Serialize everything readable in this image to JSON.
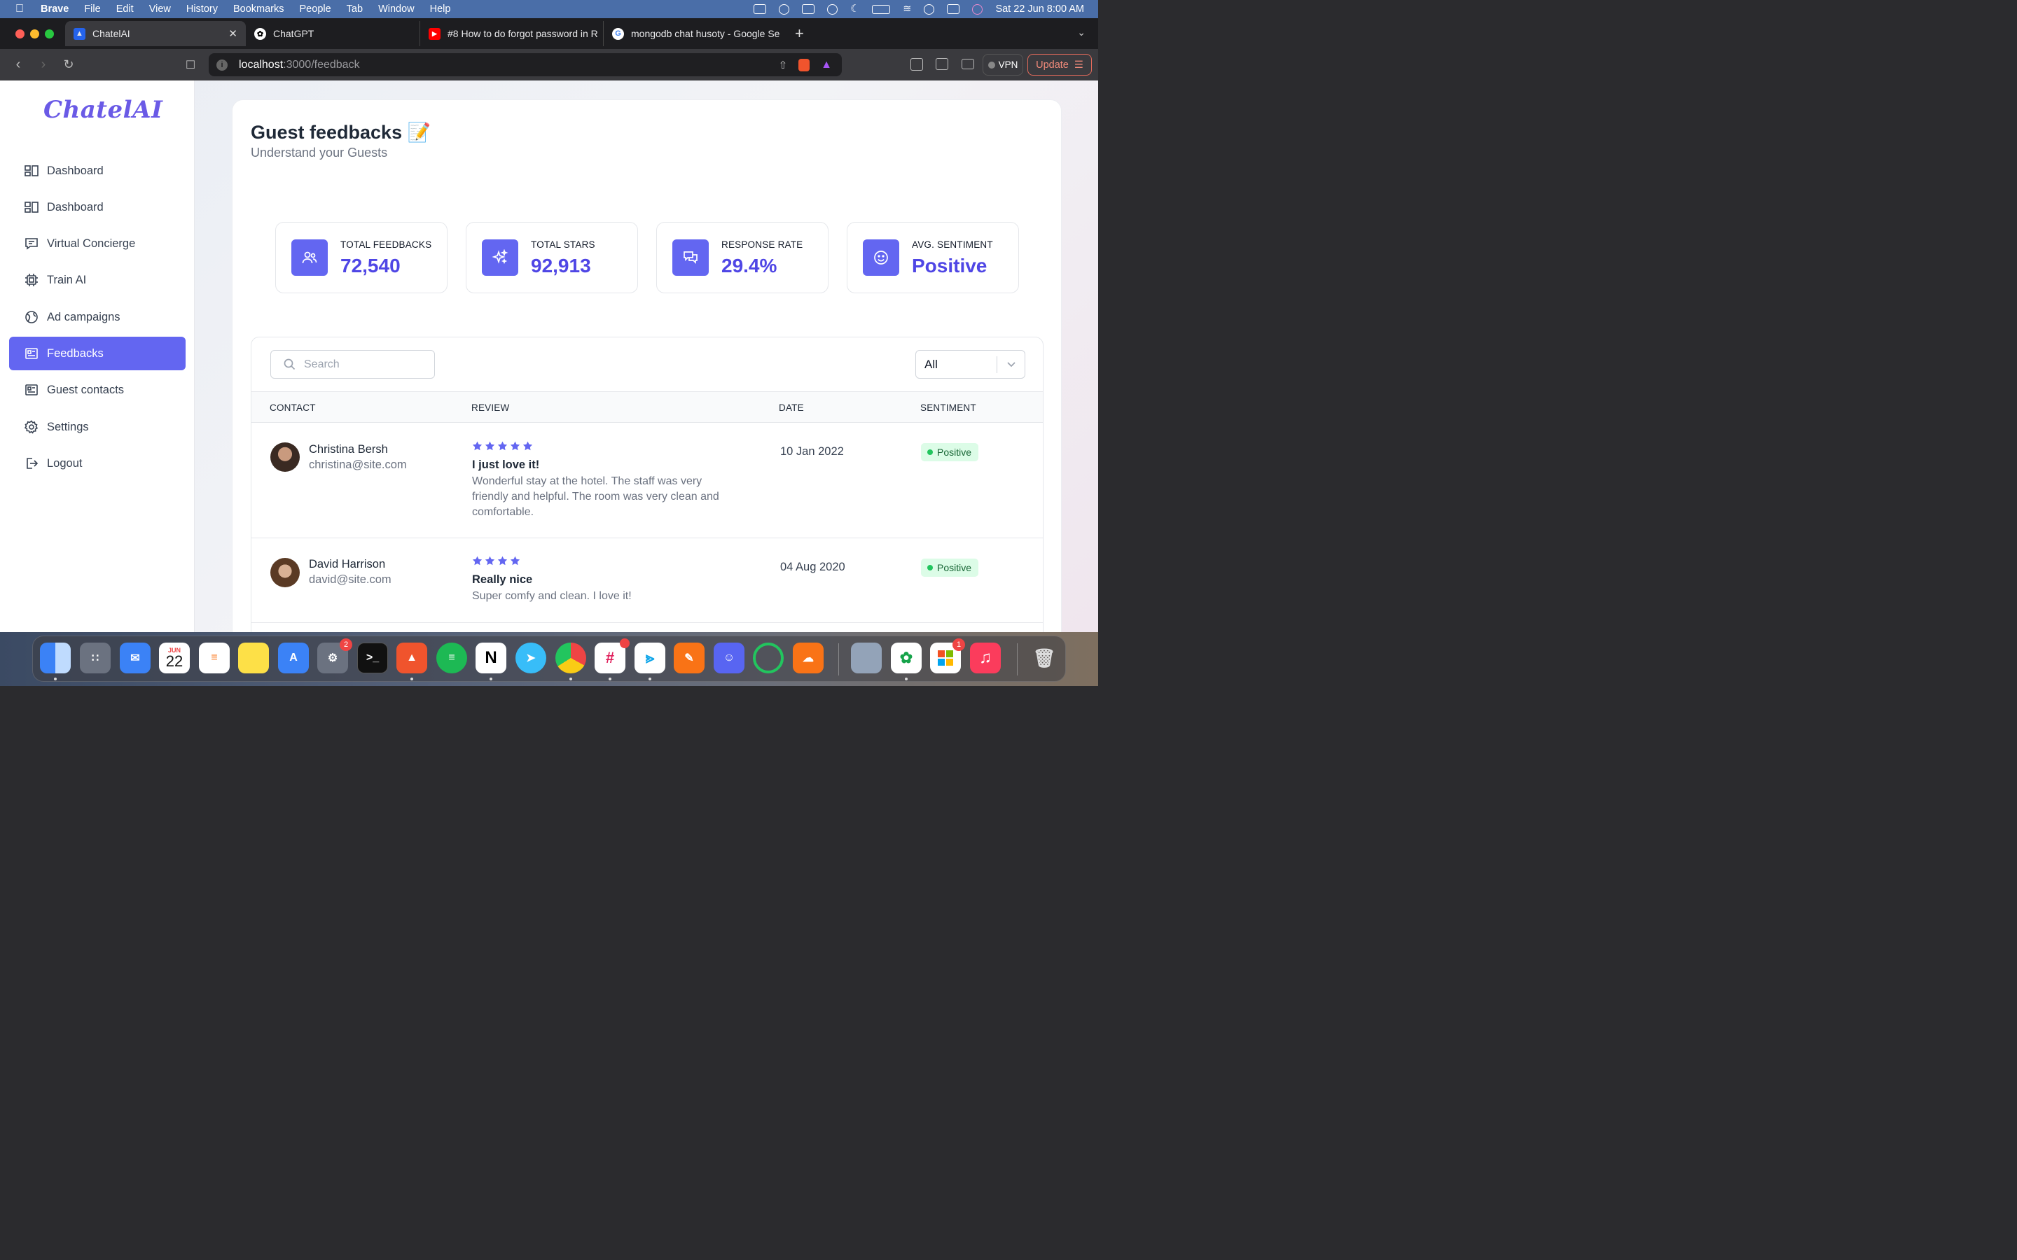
{
  "menubar": {
    "app": "Brave",
    "items": [
      "File",
      "Edit",
      "View",
      "History",
      "Bookmarks",
      "People",
      "Tab",
      "Window",
      "Help"
    ],
    "clock": "Sat 22 Jun  8:00 AM"
  },
  "browser": {
    "tabs": [
      {
        "label": "ChatelAI",
        "active": true
      },
      {
        "label": "ChatGPT"
      },
      {
        "label": "#8 How to do forgot password in R"
      },
      {
        "label": "mongodb chat husoty - Google Se"
      }
    ],
    "url_host": "localhost",
    "url_path": ":3000/feedback",
    "vpn_label": "VPN",
    "update_label": "Update"
  },
  "sidebar": {
    "logo": "ChatelAI",
    "items": [
      {
        "label": "Dashboard",
        "icon": "dashboard-icon"
      },
      {
        "label": "Dashboard",
        "icon": "dashboard-icon"
      },
      {
        "label": "Virtual Concierge",
        "icon": "chat-icon"
      },
      {
        "label": "Train AI",
        "icon": "chip-icon"
      },
      {
        "label": "Ad campaigns",
        "icon": "globe-icon"
      },
      {
        "label": "Feedbacks",
        "icon": "document-icon",
        "active": true
      },
      {
        "label": "Guest contacts",
        "icon": "contacts-icon"
      },
      {
        "label": "Settings",
        "icon": "gear-icon"
      },
      {
        "label": "Logout",
        "icon": "logout-icon"
      }
    ]
  },
  "page": {
    "title": "Guest feedbacks 📝",
    "subtitle": "Understand your Guests"
  },
  "stats": [
    {
      "label": "TOTAL FEEDBACKS",
      "value": "72,540",
      "icon": "users-icon"
    },
    {
      "label": "TOTAL STARS",
      "value": "92,913",
      "icon": "sparkles-icon"
    },
    {
      "label": "RESPONSE RATE",
      "value": "29.4%",
      "icon": "chat-bubbles-icon"
    },
    {
      "label": "AVG. SENTIMENT",
      "value": "Positive",
      "icon": "smiley-icon"
    }
  ],
  "filters": {
    "search_placeholder": "Search",
    "select_value": "All"
  },
  "table": {
    "columns": [
      "CONTACT",
      "REVIEW",
      "DATE",
      "SENTIMENT"
    ],
    "rows": [
      {
        "name": "Christina Bersh",
        "email": "christina@site.com",
        "stars": 5,
        "title": "I just love it!",
        "text": "Wonderful stay at the hotel. The staff was very friendly and helpful. The room was very clean and comfortable.",
        "date": "10 Jan 2022",
        "sentiment": "Positive"
      },
      {
        "name": "David Harrison",
        "email": "david@site.com",
        "stars": 4,
        "title": "Really nice",
        "text": "Super comfy and clean. I love it!",
        "date": "04 Aug 2020",
        "sentiment": "Positive"
      }
    ]
  },
  "dock": {
    "calendar_month": "JUN",
    "calendar_day": "22",
    "settings_badge": "2",
    "appstore_badge": "1"
  },
  "colors": {
    "accent": "#6366f1",
    "accent_text": "#4f46e5",
    "positive_bg": "#dcfce7",
    "positive_dot": "#22c55e"
  }
}
